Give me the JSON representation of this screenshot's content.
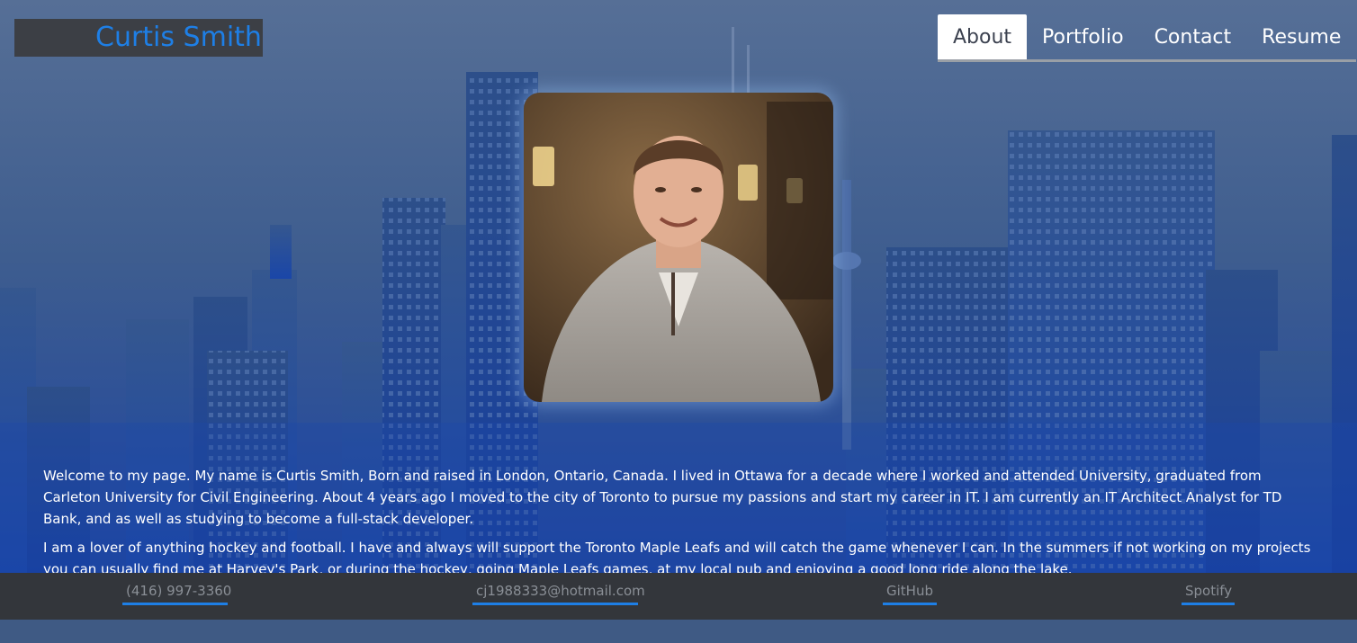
{
  "header": {
    "brand": "Curtis Smith",
    "nav": [
      {
        "label": "About",
        "active": true
      },
      {
        "label": "Portfolio",
        "active": false
      },
      {
        "label": "Contact",
        "active": false
      },
      {
        "label": "Resume",
        "active": false
      }
    ]
  },
  "about": {
    "paragraphs": [
      "Welcome to my page. My name is Curtis Smith, Born and raised in London, Ontario, Canada. I lived in Ottawa for a decade where I worked and attended University, graduated from Carleton University for Civil Engineering. About 4 years ago I moved to the city of Toronto to pursue my passions and start my career in IT. I am currently an IT Architect Analyst for TD Bank, and as well as studying to become a full-stack developer.",
      "I am a lover of anything hockey and football. I have and always will support the Toronto Maple Leafs and will catch the game whenever I can. In the summers if not working on my projects you can usually find me at Harvey's Park, or during the hockey, going Maple Leafs games, at my local pub and enjoying a good long ride along the lake."
    ]
  },
  "footer": {
    "phone": "(416) 997-3360",
    "email": "cj1988333@hotmail.com",
    "github": "GitHub",
    "spotify": "Spotify"
  },
  "colors": {
    "accent": "#1e7fe6",
    "header_box": "#3c3f45",
    "footer_bg": "#33363b",
    "sky": "#4a6690"
  },
  "icons": [
    "city-skyline-background",
    "profile-photo"
  ]
}
